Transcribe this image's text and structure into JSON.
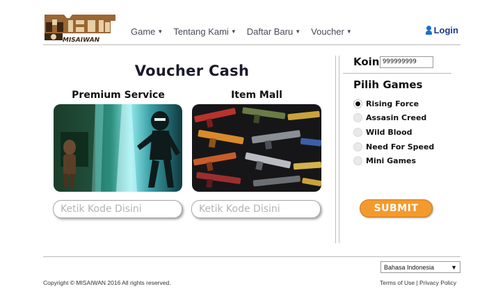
{
  "brand": {
    "logo_text": "MISAIWAN"
  },
  "nav": {
    "items": [
      {
        "label": "Game"
      },
      {
        "label": "Tentang Kami"
      },
      {
        "label": "Daftar Baru"
      },
      {
        "label": "Voucher"
      }
    ],
    "login_label": "Login"
  },
  "main": {
    "title": "Voucher Cash",
    "cards": [
      {
        "title": "Premium Service",
        "placeholder": "Ketik Kode Disini"
      },
      {
        "title": "Item Mall",
        "placeholder": "Ketik Kode Disini"
      }
    ]
  },
  "sidebar": {
    "koin_label": "Koin",
    "koin_value": "999999999",
    "games_title": "Pilih Games",
    "games": [
      {
        "label": "Rising Force",
        "selected": true
      },
      {
        "label": "Assasin Creed",
        "selected": false
      },
      {
        "label": "Wild Blood",
        "selected": false
      },
      {
        "label": "Need For Speed",
        "selected": false
      },
      {
        "label": "Mini Games",
        "selected": false
      }
    ],
    "submit_label": "SUBMIT"
  },
  "footer": {
    "language": "Bahasa Indonesia",
    "copyright": "Copyright © MISAIWAN 2016 All rights reserved.",
    "terms": "Terms of Use",
    "separator": "|",
    "privacy": "Privacy Policy"
  },
  "colors": {
    "accent": "#f39a2e",
    "login": "#1a3a8a",
    "logo_brown": "#8b5a2b"
  }
}
